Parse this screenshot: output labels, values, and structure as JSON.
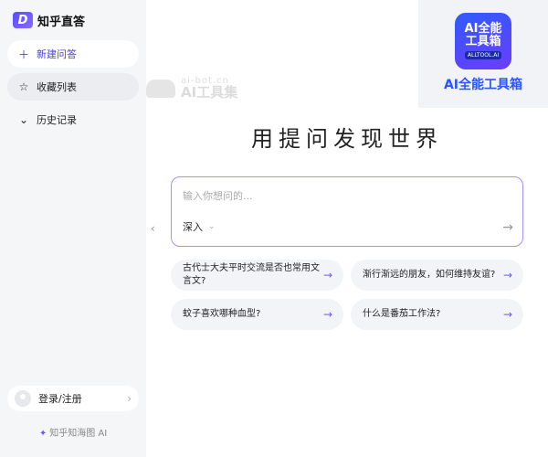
{
  "app": {
    "name": "知乎直答",
    "logo_letter": "D"
  },
  "sidebar": {
    "items": [
      {
        "label": "新建问答",
        "icon": "plus-icon"
      },
      {
        "label": "收藏列表",
        "icon": "star-icon"
      },
      {
        "label": "历史记录",
        "icon": "chevron-down-icon"
      }
    ],
    "login_label": "登录/注册",
    "footer": "知乎知海图 AI"
  },
  "watermark": {
    "url": "ai-bot.cn",
    "name": "AI工具集"
  },
  "ad": {
    "tile_line1": "AI全能",
    "tile_line2": "工具箱",
    "tile_line3": "ALLTOOL.AI",
    "caption": "AI全能工具箱"
  },
  "main": {
    "headline": "用提问发现世界",
    "input_placeholder": "输入你想问的...",
    "mode_label": "深入",
    "suggestions": [
      "古代士大夫平时交流是否也常用文言文?",
      "渐行渐远的朋友，如何维持友谊?",
      "蚊子喜欢哪种血型?",
      "什么是番茄工作法?"
    ]
  },
  "colors": {
    "accent": "#4b3fe4",
    "border": "#a591ff",
    "ad_blue": "#2a55ff"
  }
}
